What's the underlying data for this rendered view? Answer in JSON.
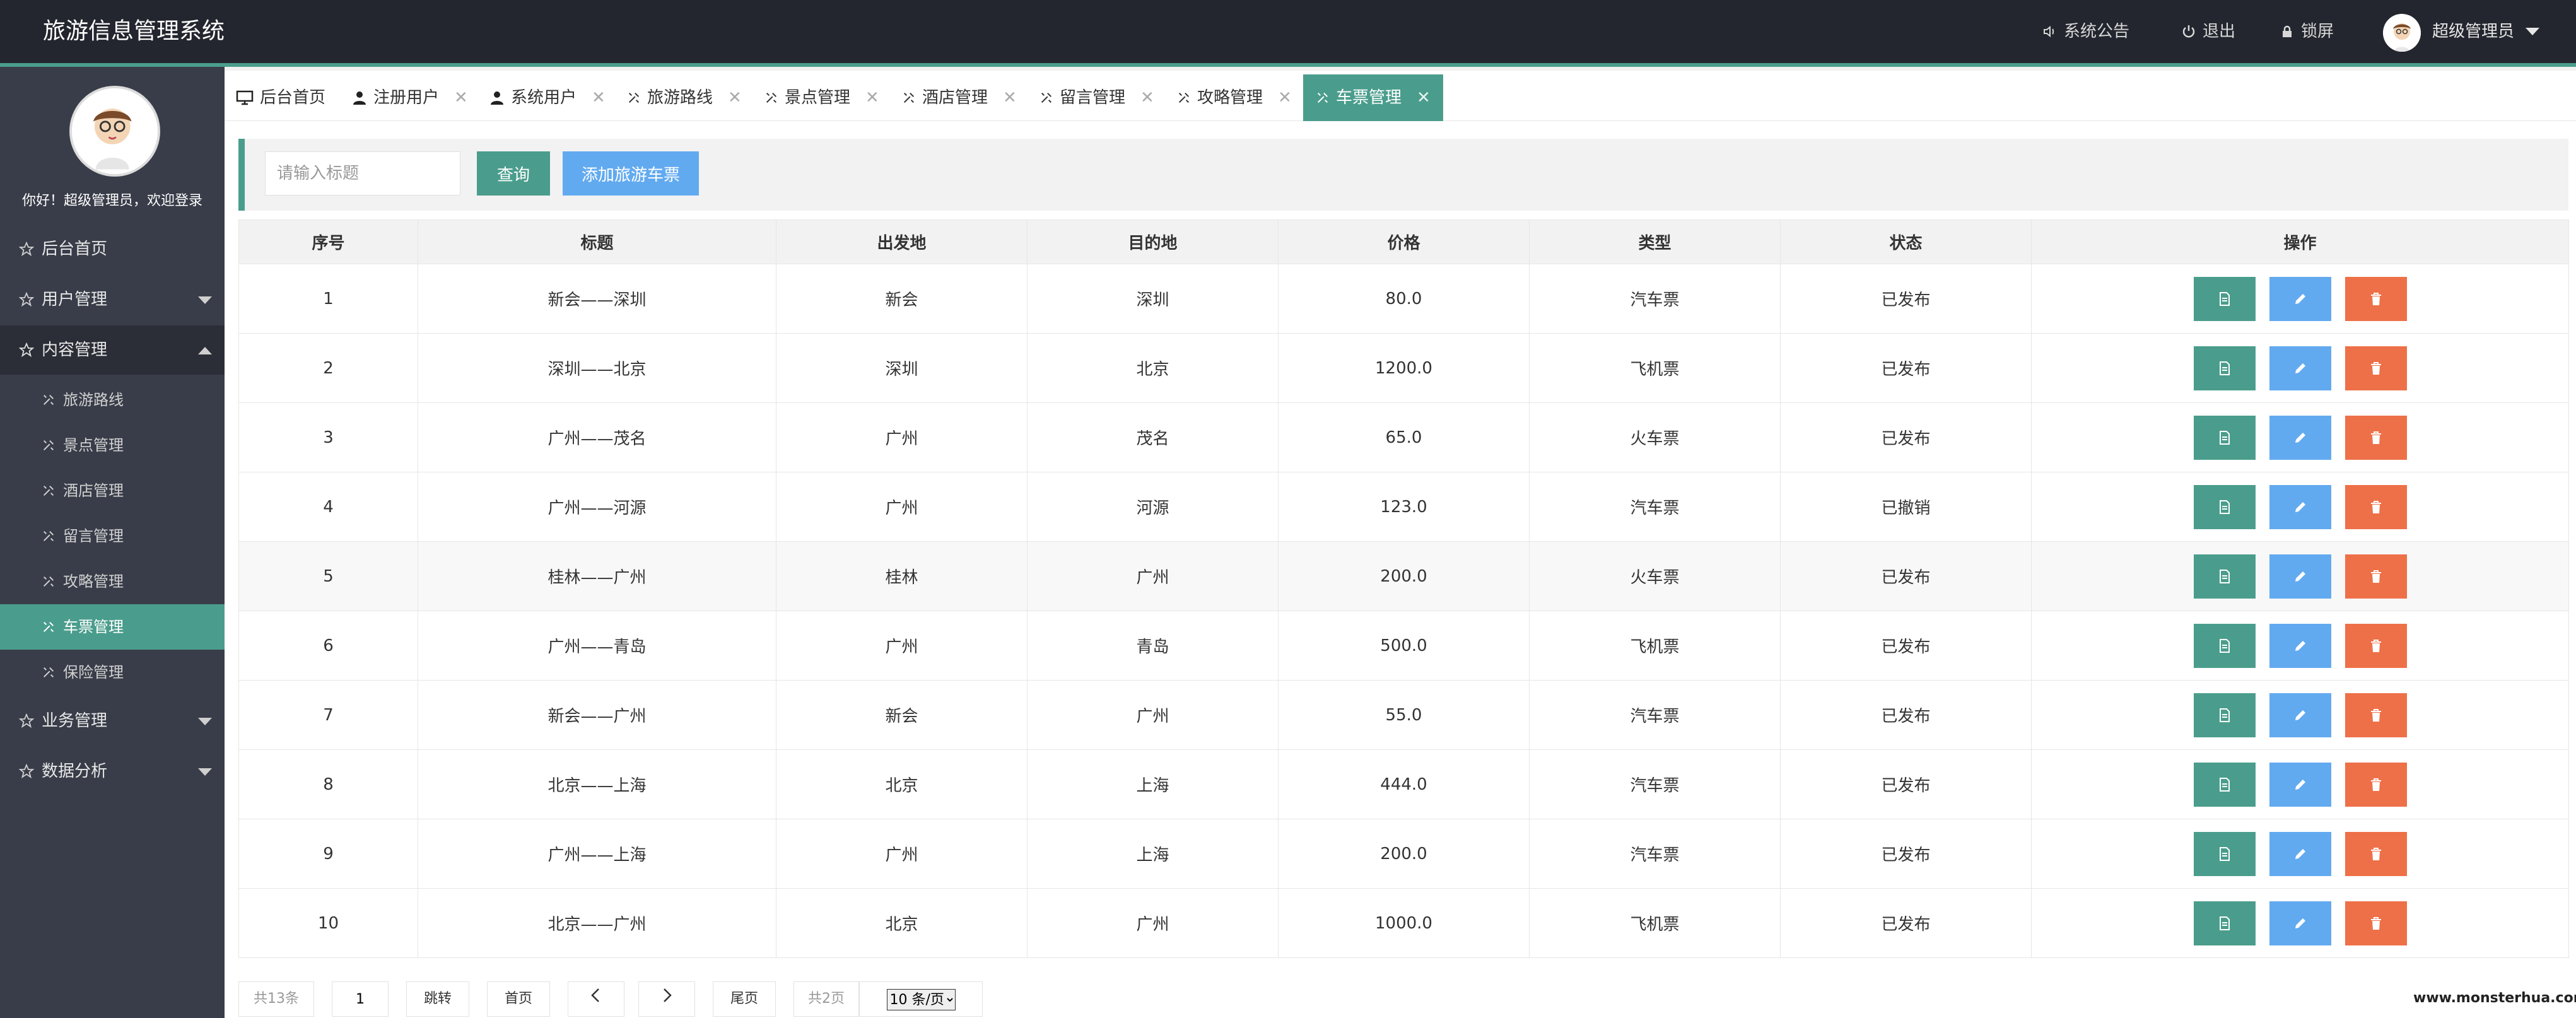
{
  "header": {
    "title": "旅游信息管理系统",
    "notice": "系统公告",
    "logout": "退出",
    "lock": "锁屏",
    "user": "超级管理员"
  },
  "sidebar": {
    "welcome": "你好！超级管理员，欢迎登录",
    "items": [
      {
        "label": "后台首页"
      },
      {
        "label": "用户管理"
      },
      {
        "label": "内容管理"
      },
      {
        "label": "业务管理"
      },
      {
        "label": "数据分析"
      }
    ],
    "sub": [
      {
        "label": "旅游路线"
      },
      {
        "label": "景点管理"
      },
      {
        "label": "酒店管理"
      },
      {
        "label": "留言管理"
      },
      {
        "label": "攻略管理"
      },
      {
        "label": "车票管理"
      },
      {
        "label": "保险管理"
      }
    ]
  },
  "tabs": [
    {
      "label": "后台首页"
    },
    {
      "label": "注册用户"
    },
    {
      "label": "系统用户"
    },
    {
      "label": "旅游路线"
    },
    {
      "label": "景点管理"
    },
    {
      "label": "酒店管理"
    },
    {
      "label": "留言管理"
    },
    {
      "label": "攻略管理"
    },
    {
      "label": "车票管理"
    }
  ],
  "search": {
    "placeholder": "请输入标题",
    "query_label": "查询",
    "add_label": "添加旅游车票"
  },
  "table": {
    "headers": [
      "序号",
      "标题",
      "出发地",
      "目的地",
      "价格",
      "类型",
      "状态",
      "操作"
    ],
    "rows": [
      [
        "1",
        "新会——深圳",
        "新会",
        "深圳",
        "80.0",
        "汽车票",
        "已发布"
      ],
      [
        "2",
        "深圳——北京",
        "深圳",
        "北京",
        "1200.0",
        "飞机票",
        "已发布"
      ],
      [
        "3",
        "广州——茂名",
        "广州",
        "茂名",
        "65.0",
        "火车票",
        "已发布"
      ],
      [
        "4",
        "广州——河源",
        "广州",
        "河源",
        "123.0",
        "汽车票",
        "已撤销"
      ],
      [
        "5",
        "桂林——广州",
        "桂林",
        "广州",
        "200.0",
        "火车票",
        "已发布"
      ],
      [
        "6",
        "广州——青岛",
        "广州",
        "青岛",
        "500.0",
        "飞机票",
        "已发布"
      ],
      [
        "7",
        "新会——广州",
        "新会",
        "广州",
        "55.0",
        "汽车票",
        "已发布"
      ],
      [
        "8",
        "北京——上海",
        "北京",
        "上海",
        "444.0",
        "汽车票",
        "已发布"
      ],
      [
        "9",
        "广州——上海",
        "广州",
        "上海",
        "200.0",
        "汽车票",
        "已发布"
      ],
      [
        "10",
        "北京——广州",
        "北京",
        "广州",
        "1000.0",
        "飞机票",
        "已发布"
      ]
    ]
  },
  "pager": {
    "total": "共13条",
    "page": "1",
    "jump": "跳转",
    "first": "首页",
    "last": "尾页",
    "pages": "共2页",
    "per_page": "10 条/页"
  },
  "watermark": "www.monsterhua.com",
  "colors": {
    "header_bg": "#23262e",
    "sidebar_bg": "#393d49",
    "accent": "#4a9d8c",
    "blue": "#62aaf0",
    "danger": "#ee7048"
  }
}
